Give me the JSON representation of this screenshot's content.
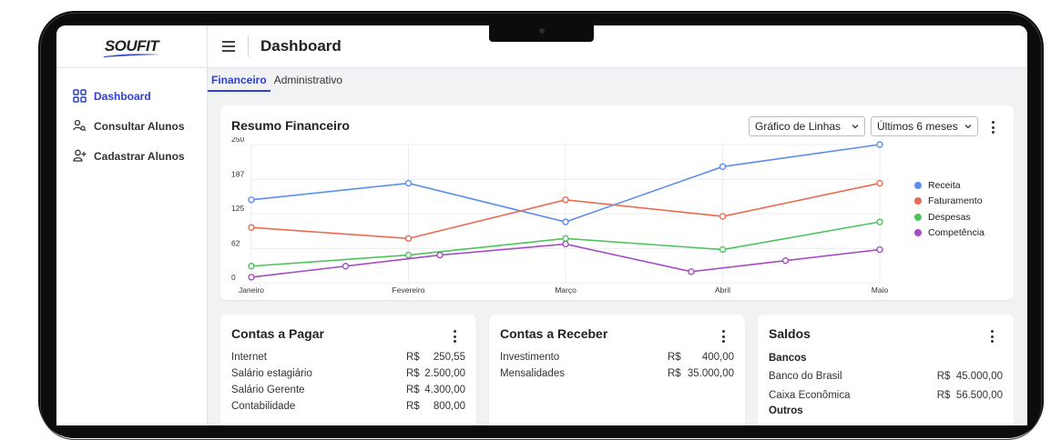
{
  "app": {
    "logo": "SOUFIT"
  },
  "sidebar": {
    "items": [
      {
        "label": "Dashboard",
        "icon": "dashboard-grid-icon",
        "active": true
      },
      {
        "label": "Consultar Alunos",
        "icon": "users-search-icon",
        "active": false
      },
      {
        "label": "Cadastrar Alunos",
        "icon": "user-add-icon",
        "active": false
      }
    ]
  },
  "header": {
    "title": "Dashboard",
    "menu_icon": "hamburger-menu-icon"
  },
  "tabs": [
    {
      "label": "Financeiro",
      "active": true
    },
    {
      "label": "Administrativo",
      "active": false
    }
  ],
  "resumo": {
    "title": "Resumo Financeiro",
    "chart_type_select": "Gráfico de Linhas",
    "period_select": "Últimos 6 meses"
  },
  "chart_data": {
    "type": "line",
    "x": [
      "Janeiro",
      "Fevereiro",
      "Março",
      "Abril",
      "Maio"
    ],
    "yticks": [
      "250",
      "187",
      "125",
      "62",
      "0"
    ],
    "ylim": [
      0,
      250
    ],
    "grid": true,
    "legend_position": "right",
    "series": [
      {
        "name": "Receita",
        "color": "#5b8def",
        "points": [
          [
            0,
            150
          ],
          [
            1,
            180
          ],
          [
            2,
            110
          ],
          [
            3,
            210
          ],
          [
            4,
            250
          ]
        ]
      },
      {
        "name": "Faturamento",
        "color": "#ec6a50",
        "points": [
          [
            0,
            100
          ],
          [
            1,
            80
          ],
          [
            2,
            150
          ],
          [
            3,
            120
          ],
          [
            4,
            180
          ]
        ]
      },
      {
        "name": "Despesas",
        "color": "#4cc45c",
        "points": [
          [
            0,
            30
          ],
          [
            1,
            50
          ],
          [
            2,
            80
          ],
          [
            3,
            60
          ],
          [
            4,
            110
          ]
        ]
      },
      {
        "name": "Competência",
        "color": "#a54cc6",
        "points": [
          [
            0,
            10
          ],
          [
            0.6,
            30
          ],
          [
            1.2,
            50
          ],
          [
            2,
            70
          ],
          [
            2.8,
            20
          ],
          [
            3.4,
            40
          ],
          [
            4,
            60
          ]
        ]
      }
    ]
  },
  "contas_pagar": {
    "title": "Contas a Pagar",
    "items": [
      {
        "label": "Internet",
        "currency": "R$",
        "value": "250,55"
      },
      {
        "label": "Salário estagiário",
        "currency": "R$",
        "value": "2.500,00"
      },
      {
        "label": "Salário Gerente",
        "currency": "R$",
        "value": "4.300,00"
      },
      {
        "label": "Contabilidade",
        "currency": "R$",
        "value": "800,00"
      }
    ]
  },
  "contas_receber": {
    "title": "Contas a Receber",
    "items": [
      {
        "label": "Investimento",
        "currency": "R$",
        "value": "400,00"
      },
      {
        "label": "Mensalidades",
        "currency": "R$",
        "value": "35.000,00"
      }
    ]
  },
  "saldos": {
    "title": "Saldos",
    "bancos_label": "Bancos",
    "items": [
      {
        "label": "Banco do Brasil",
        "value": "R$  45.000,00"
      },
      {
        "label": "Caixa Econômica",
        "value": "R$  56.500,00"
      }
    ],
    "outros_label": "Outros"
  },
  "colors": {
    "accent": "#2c3fd0",
    "background": "#f1f2f4"
  }
}
